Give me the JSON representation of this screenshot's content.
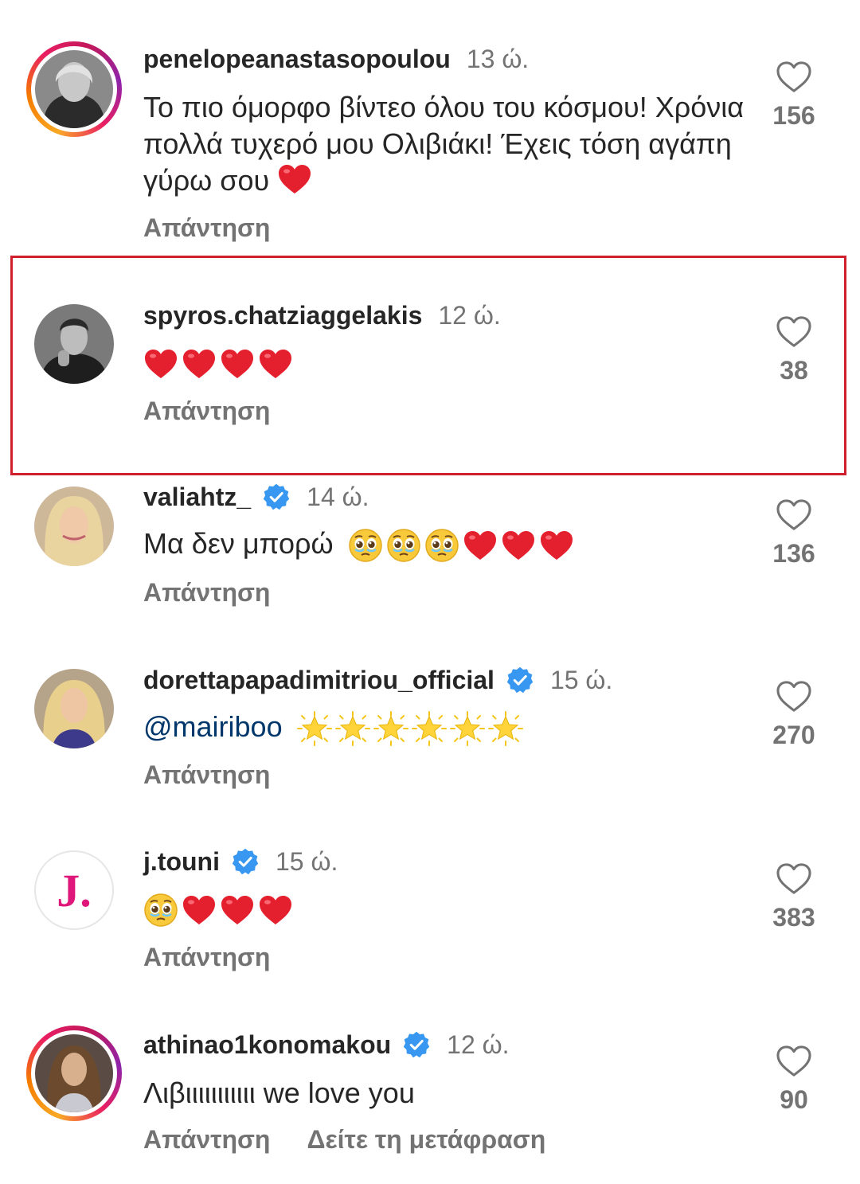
{
  "comments": [
    {
      "username": "penelopeanastasopoulou",
      "time": "13 ώ.",
      "verified": false,
      "story_ring": true,
      "text": "Το πιο όμορφο βίντεο όλου του κόσμου! Χρόνια πολλά τυχερό μου Ολιβιάκι! Έχεις τόση αγάπη γύρω σου",
      "emoji": [
        "red-heart"
      ],
      "likes": "156",
      "reply_label": "Απάντηση"
    },
    {
      "username": "spyros.chatziaggelakis",
      "time": "12 ώ.",
      "verified": false,
      "story_ring": false,
      "text": "",
      "emoji": [
        "red-heart",
        "red-heart",
        "red-heart",
        "red-heart"
      ],
      "likes": "38",
      "reply_label": "Απάντηση",
      "highlighted": true
    },
    {
      "username": "valiahtz_",
      "time": "14 ώ.",
      "verified": true,
      "story_ring": false,
      "text": "Μα δεν μπορώ",
      "emoji": [
        "pleading-face",
        "pleading-face",
        "pleading-face",
        "red-heart",
        "red-heart",
        "red-heart"
      ],
      "likes": "136",
      "reply_label": "Απάντηση"
    },
    {
      "username": "dorettapapadimitriou_official",
      "time": "15 ώ.",
      "verified": true,
      "story_ring": false,
      "mention": "@mairiboo",
      "emoji": [
        "star",
        "star",
        "star",
        "star",
        "star",
        "star"
      ],
      "likes": "270",
      "reply_label": "Απάντηση"
    },
    {
      "username": "j.touni",
      "time": "15 ώ.",
      "verified": true,
      "story_ring": false,
      "avatar_letter": "J.",
      "text": "",
      "emoji": [
        "pleading-face",
        "red-heart",
        "red-heart",
        "red-heart"
      ],
      "likes": "383",
      "reply_label": "Απάντηση"
    },
    {
      "username": "athinao1konomakou",
      "time": "12 ώ.",
      "verified": true,
      "story_ring": true,
      "text": "Λιβιιιιιιιιιιι we love you",
      "emoji": [],
      "likes": "90",
      "reply_label": "Απάντηση",
      "translate_label": "Δείτε τη μετάφραση"
    }
  ],
  "colors": {
    "highlight_border": "#d0202e",
    "verified_badge": "#3897f0",
    "mention": "#00376b",
    "secondary_text": "#737373"
  }
}
